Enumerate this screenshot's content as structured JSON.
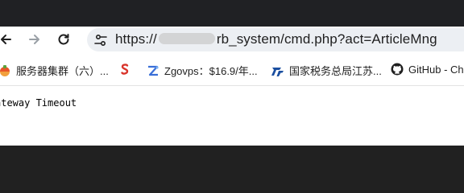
{
  "browser": {
    "url": {
      "prefix": "https://",
      "suffix": "rb_system/cmd.php?act=ArticleMng"
    }
  },
  "bookmarks": [
    {
      "label": "服务器集群（六）...",
      "icon": "server-cluster-icon",
      "color": "#e8562a"
    },
    {
      "label": "",
      "icon": "red-s-logo-icon",
      "color": "#d9342b"
    },
    {
      "label": "Zgovps：$16.9/年...",
      "icon": "zgovps-icon",
      "color": "#3a6fd8"
    },
    {
      "label": "国家税务总局江苏...",
      "icon": "tax-bureau-icon",
      "color": "#1b4fa0"
    },
    {
      "label": "GitHub - Ch",
      "icon": "github-icon",
      "color": "#1f1f1f"
    }
  ],
  "page": {
    "body_text": "ateway Timeout"
  },
  "colors": {
    "chrome_dark": "#212121",
    "toolbar_bg": "#ffffff",
    "omnibox_bg": "#eceff3"
  }
}
